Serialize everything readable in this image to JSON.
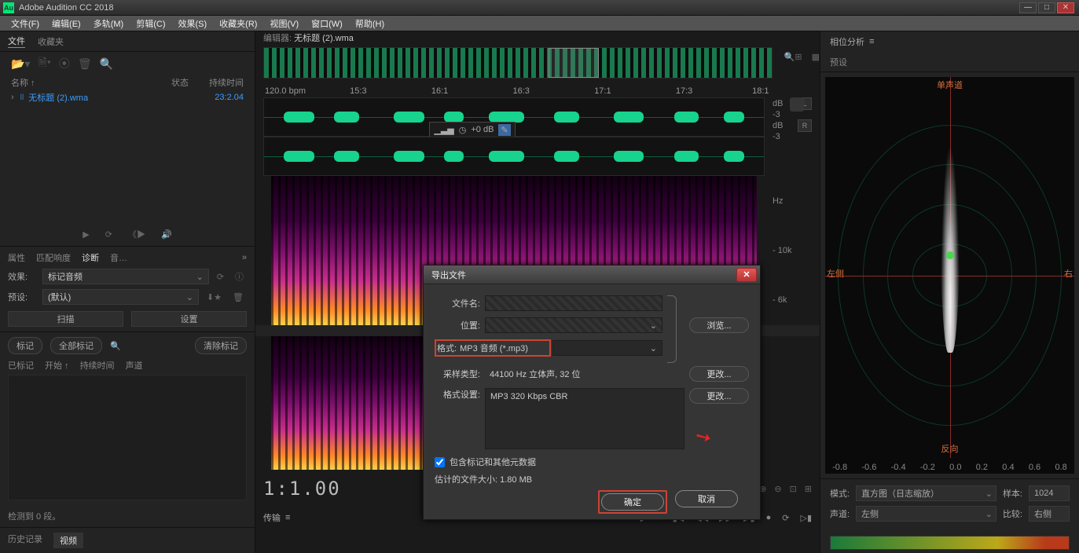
{
  "app_title": "Adobe Audition CC 2018",
  "menu": [
    "文件(F)",
    "编辑(E)",
    "多轨(M)",
    "剪辑(C)",
    "效果(S)",
    "收藏夹(R)",
    "视图(V)",
    "窗口(W)",
    "帮助(H)"
  ],
  "left": {
    "tabs": {
      "files": "文件",
      "favorites": "收藏夹"
    },
    "header": {
      "name": "名称 ↑",
      "status": "状态",
      "duration": "持续时间"
    },
    "file": {
      "name": "无标题 (2).wma",
      "duration": "23:2.04"
    },
    "diag_tabs": {
      "props": "属性",
      "match": "匹配响度",
      "diag": "诊断",
      "audio": "音…"
    },
    "effect_label": "效果:",
    "effect_value": "标记音频",
    "preset_label": "预设:",
    "preset_value": "(默认)",
    "scan": "扫描",
    "settings": "设置",
    "mark": "标记",
    "all_mark": "全部标记",
    "clear_mark": "清除标记",
    "mk_header": {
      "marked": "已标记",
      "start": "开始 ↑",
      "duration": "持续时间",
      "channel": "声道"
    },
    "detect": "检测到 0 段。",
    "hist": {
      "history": "历史记录",
      "video": "视频"
    }
  },
  "center": {
    "editor_label": "编辑器:",
    "editor_file": "无标题 (2).wma",
    "bpm": "120.0 bpm",
    "ruler_ticks": [
      "15:3",
      "16:1",
      "16:3",
      "17:1",
      "17:3",
      "18:1"
    ],
    "gain": "+0 dB",
    "db_labels": [
      "dB",
      "-3",
      "dB",
      "-3"
    ],
    "side_chan": [
      "L",
      "R"
    ],
    "hz_labels": [
      "Hz",
      "- 10k",
      "- 6k"
    ],
    "time": "1:1.00",
    "transfer": "传输"
  },
  "right": {
    "phase_title": "相位分析",
    "preset_label": "预设",
    "side_l": "左侧",
    "side_r": "右",
    "top_label": "单声道",
    "bottom_label": "反向",
    "scale": [
      "-0.8",
      "-0.6",
      "-0.4",
      "-0.2",
      "0.0",
      "0.2",
      "0.4",
      "0.6",
      "0.8"
    ],
    "mode_label": "模式:",
    "mode_value": "直方图（日志缩放）",
    "sample_label": "样本:",
    "sample_value": "1024",
    "chan_label": "声道:",
    "chan_value": "左侧",
    "compare_label": "比较:",
    "compare_value": "右侧"
  },
  "dialog": {
    "title": "导出文件",
    "filename_label": "文件名:",
    "location_label": "位置:",
    "browse": "浏览...",
    "format_label": "格式:",
    "format_value": "MP3 音频 (*.mp3)",
    "sample_label": "采样类型:",
    "sample_value": "44100 Hz 立体声, 32 位",
    "change": "更改...",
    "fmtset_label": "格式设置:",
    "fmtset_value": "MP3 320 Kbps CBR",
    "include": "包含标记和其他元数据",
    "estimate_label": "估计的文件大小:",
    "estimate_value": "1.80 MB",
    "ok": "确定",
    "cancel": "取消"
  }
}
